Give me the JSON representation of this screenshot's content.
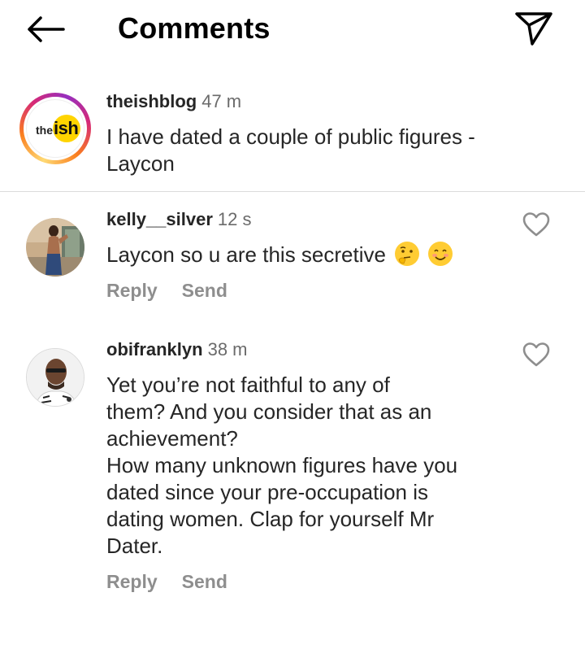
{
  "header": {
    "title": "Comments",
    "back_icon": "arrow-left-icon",
    "send_icon": "paper-plane-icon"
  },
  "caption": {
    "username": "theishblog",
    "time": "47 m",
    "text": "I have dated a couple of public figures -\nLaycon",
    "avatar": {
      "logo_the": "the",
      "logo_ish": "ish"
    }
  },
  "comments": [
    {
      "username": "kelly__silver",
      "time": "12 s",
      "text": "Laycon so u are this secretive",
      "emojis": [
        "thinking-face",
        "smiling-face"
      ],
      "reply_label": "Reply",
      "send_label": "Send"
    },
    {
      "username": "obifranklyn",
      "time": "38 m",
      "text": "Yet you’re not faithful to any of\nthem? And you consider that as an\nachievement?\nHow many unknown figures have you\ndated since your pre-occupation is\ndating women. Clap for yourself Mr\nDater.",
      "reply_label": "Reply",
      "send_label": "Send"
    }
  ],
  "colors": {
    "ish_yellow": "#ffd400",
    "muted": "#8e8e8e",
    "divider": "#dbdbdb"
  }
}
